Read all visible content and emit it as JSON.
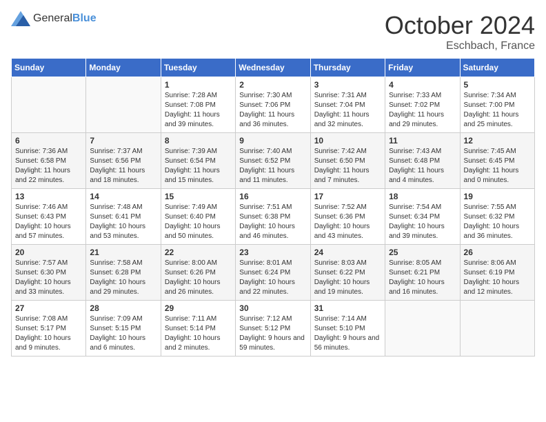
{
  "header": {
    "logo_general": "General",
    "logo_blue": "Blue",
    "month_title": "October 2024",
    "location": "Eschbach, France"
  },
  "days_of_week": [
    "Sunday",
    "Monday",
    "Tuesday",
    "Wednesday",
    "Thursday",
    "Friday",
    "Saturday"
  ],
  "weeks": [
    [
      {
        "day": "",
        "info": ""
      },
      {
        "day": "",
        "info": ""
      },
      {
        "day": "1",
        "sunrise": "7:28 AM",
        "sunset": "7:08 PM",
        "daylight": "11 hours and 39 minutes."
      },
      {
        "day": "2",
        "sunrise": "7:30 AM",
        "sunset": "7:06 PM",
        "daylight": "11 hours and 36 minutes."
      },
      {
        "day": "3",
        "sunrise": "7:31 AM",
        "sunset": "7:04 PM",
        "daylight": "11 hours and 32 minutes."
      },
      {
        "day": "4",
        "sunrise": "7:33 AM",
        "sunset": "7:02 PM",
        "daylight": "11 hours and 29 minutes."
      },
      {
        "day": "5",
        "sunrise": "7:34 AM",
        "sunset": "7:00 PM",
        "daylight": "11 hours and 25 minutes."
      }
    ],
    [
      {
        "day": "6",
        "sunrise": "7:36 AM",
        "sunset": "6:58 PM",
        "daylight": "11 hours and 22 minutes."
      },
      {
        "day": "7",
        "sunrise": "7:37 AM",
        "sunset": "6:56 PM",
        "daylight": "11 hours and 18 minutes."
      },
      {
        "day": "8",
        "sunrise": "7:39 AM",
        "sunset": "6:54 PM",
        "daylight": "11 hours and 15 minutes."
      },
      {
        "day": "9",
        "sunrise": "7:40 AM",
        "sunset": "6:52 PM",
        "daylight": "11 hours and 11 minutes."
      },
      {
        "day": "10",
        "sunrise": "7:42 AM",
        "sunset": "6:50 PM",
        "daylight": "11 hours and 7 minutes."
      },
      {
        "day": "11",
        "sunrise": "7:43 AM",
        "sunset": "6:48 PM",
        "daylight": "11 hours and 4 minutes."
      },
      {
        "day": "12",
        "sunrise": "7:45 AM",
        "sunset": "6:45 PM",
        "daylight": "11 hours and 0 minutes."
      }
    ],
    [
      {
        "day": "13",
        "sunrise": "7:46 AM",
        "sunset": "6:43 PM",
        "daylight": "10 hours and 57 minutes."
      },
      {
        "day": "14",
        "sunrise": "7:48 AM",
        "sunset": "6:41 PM",
        "daylight": "10 hours and 53 minutes."
      },
      {
        "day": "15",
        "sunrise": "7:49 AM",
        "sunset": "6:40 PM",
        "daylight": "10 hours and 50 minutes."
      },
      {
        "day": "16",
        "sunrise": "7:51 AM",
        "sunset": "6:38 PM",
        "daylight": "10 hours and 46 minutes."
      },
      {
        "day": "17",
        "sunrise": "7:52 AM",
        "sunset": "6:36 PM",
        "daylight": "10 hours and 43 minutes."
      },
      {
        "day": "18",
        "sunrise": "7:54 AM",
        "sunset": "6:34 PM",
        "daylight": "10 hours and 39 minutes."
      },
      {
        "day": "19",
        "sunrise": "7:55 AM",
        "sunset": "6:32 PM",
        "daylight": "10 hours and 36 minutes."
      }
    ],
    [
      {
        "day": "20",
        "sunrise": "7:57 AM",
        "sunset": "6:30 PM",
        "daylight": "10 hours and 33 minutes."
      },
      {
        "day": "21",
        "sunrise": "7:58 AM",
        "sunset": "6:28 PM",
        "daylight": "10 hours and 29 minutes."
      },
      {
        "day": "22",
        "sunrise": "8:00 AM",
        "sunset": "6:26 PM",
        "daylight": "10 hours and 26 minutes."
      },
      {
        "day": "23",
        "sunrise": "8:01 AM",
        "sunset": "6:24 PM",
        "daylight": "10 hours and 22 minutes."
      },
      {
        "day": "24",
        "sunrise": "8:03 AM",
        "sunset": "6:22 PM",
        "daylight": "10 hours and 19 minutes."
      },
      {
        "day": "25",
        "sunrise": "8:05 AM",
        "sunset": "6:21 PM",
        "daylight": "10 hours and 16 minutes."
      },
      {
        "day": "26",
        "sunrise": "8:06 AM",
        "sunset": "6:19 PM",
        "daylight": "10 hours and 12 minutes."
      }
    ],
    [
      {
        "day": "27",
        "sunrise": "7:08 AM",
        "sunset": "5:17 PM",
        "daylight": "10 hours and 9 minutes."
      },
      {
        "day": "28",
        "sunrise": "7:09 AM",
        "sunset": "5:15 PM",
        "daylight": "10 hours and 6 minutes."
      },
      {
        "day": "29",
        "sunrise": "7:11 AM",
        "sunset": "5:14 PM",
        "daylight": "10 hours and 2 minutes."
      },
      {
        "day": "30",
        "sunrise": "7:12 AM",
        "sunset": "5:12 PM",
        "daylight": "9 hours and 59 minutes."
      },
      {
        "day": "31",
        "sunrise": "7:14 AM",
        "sunset": "5:10 PM",
        "daylight": "9 hours and 56 minutes."
      },
      {
        "day": "",
        "info": ""
      },
      {
        "day": "",
        "info": ""
      }
    ]
  ]
}
